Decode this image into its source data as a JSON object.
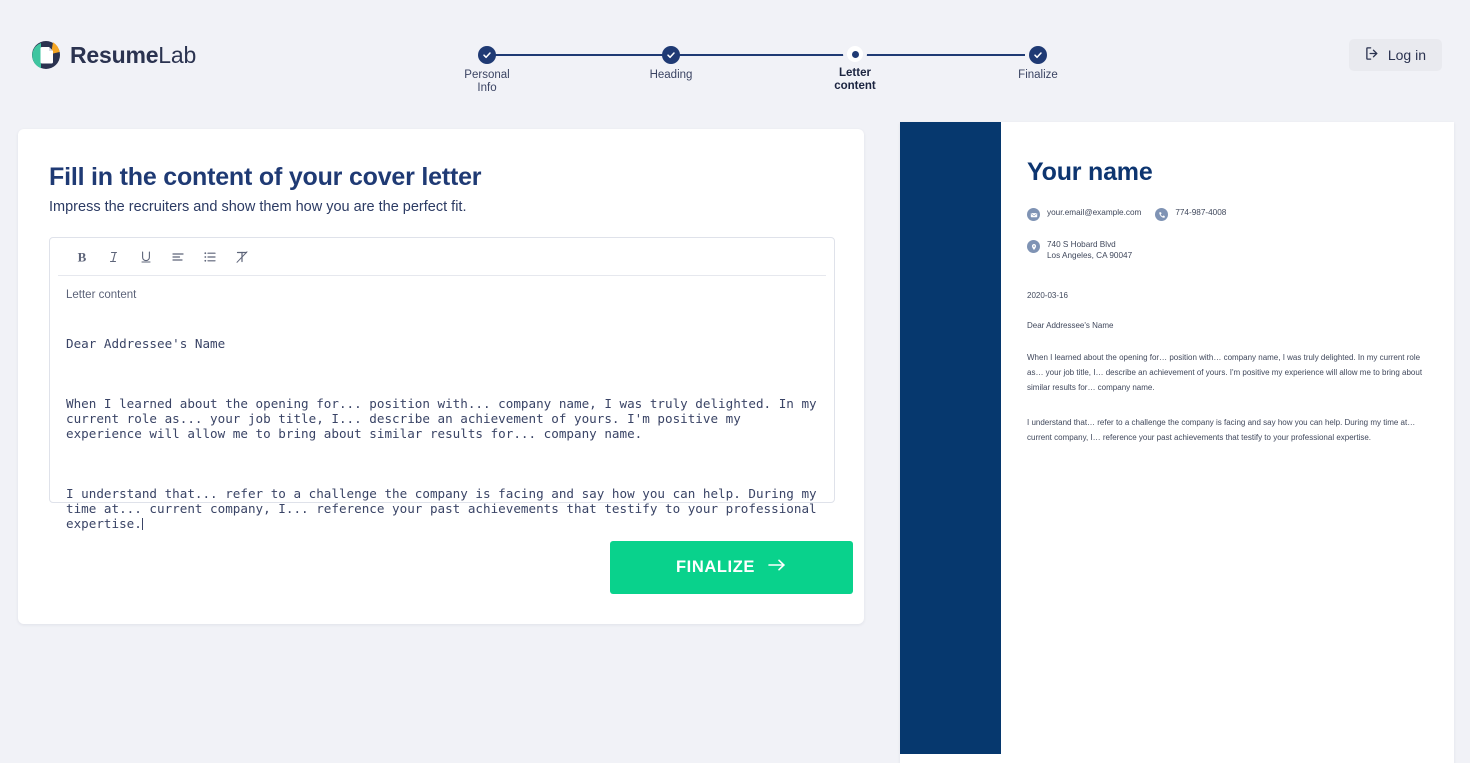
{
  "brand": {
    "name_bold": "Resume",
    "name_light": "Lab",
    "logo_icon": "resumelab-document-circle-icon",
    "navy": "#1f3a74",
    "accent_green": "#09d28c",
    "preview_navy": "#06386e"
  },
  "header": {
    "login_label": "Log in",
    "login_icon": "login-arrow-icon"
  },
  "stepper": {
    "steps": [
      {
        "label_line1": "Personal",
        "label_line2": "Info",
        "state": "complete",
        "icon": "check-icon"
      },
      {
        "label_line1": "Heading",
        "label_line2": "",
        "state": "complete",
        "icon": "check-icon"
      },
      {
        "label_line1": "Letter",
        "label_line2": "content",
        "state": "active",
        "icon": "dot-icon"
      },
      {
        "label_line1": "Finalize",
        "label_line2": "",
        "state": "complete",
        "icon": "check-icon"
      }
    ]
  },
  "form": {
    "title": "Fill in the content of your cover letter",
    "subtitle": "Impress the recruiters and show them how you are the perfect fit.",
    "toolbar": [
      {
        "name": "bold-icon",
        "label": "B"
      },
      {
        "name": "italic-icon",
        "label": "I"
      },
      {
        "name": "underline-icon",
        "label": "U"
      },
      {
        "name": "align-left-icon",
        "label": ""
      },
      {
        "name": "bullet-list-icon",
        "label": ""
      },
      {
        "name": "clear-formatting-icon",
        "label": ""
      }
    ],
    "field_label": "Letter content",
    "letter": {
      "greeting": "Dear Addressee's Name",
      "paragraph1": "When I learned about the opening for... position with... company name, I was truly delighted. In my current role as... your job title, I... describe an achievement of yours. I'm positive my experience will allow me to bring about similar results for... company name.",
      "paragraph2": "I understand that... refer to a challenge the company is facing and say how you can help. During my time at... current company, I... reference your past achievements that testify to your professional expertise."
    },
    "finalize_label": "FINALIZE",
    "finalize_icon": "arrow-right-icon"
  },
  "preview": {
    "name": "Your name",
    "email": "your.email@example.com",
    "email_icon": "envelope-icon",
    "phone": "774-987-4008",
    "phone_icon": "phone-icon",
    "address_line1": "740 S Hobard Blvd",
    "address_line2": "Los Angeles, CA 90047",
    "address_icon": "location-pin-icon",
    "date": "2020-03-16",
    "greeting": "Dear Addressee's Name",
    "paragraph1": "When I learned about the opening for… position with… company name, I was truly delighted. In my current role as… your job title, I… describe an achievement of yours. I'm positive my experience will allow me to bring about similar results for… company name.",
    "paragraph2": "I understand that… refer to a challenge the company is facing and say how you can help. During my time at… current company, I… reference your past achievements that testify to your professional expertise."
  }
}
